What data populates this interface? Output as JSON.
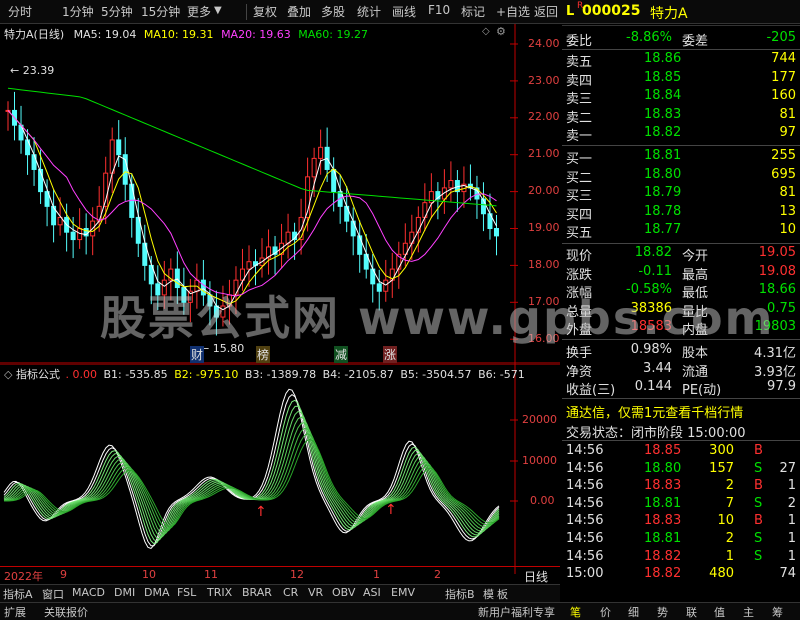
{
  "toolbar": {
    "periods": [
      "分时",
      "1分钟",
      "5分钟",
      "15分钟",
      "更多"
    ],
    "tools": [
      "复权",
      "叠加",
      "多股",
      "统计",
      "画线",
      "F10",
      "标记",
      "+自选",
      "返回"
    ]
  },
  "main": {
    "name": "特力A",
    "mode": "(日线)",
    "ma5": "MA5: 19.04",
    "ma10": "MA10: 19.31",
    "ma20": "MA20: 19.63",
    "ma60": "MA60: 19.27",
    "yticks": [
      "24.00",
      "23.00",
      "22.00",
      "21.00",
      "20.00",
      "19.00",
      "18.00",
      "17.00",
      "16.00"
    ],
    "high_label": "23.39",
    "low_label": "15.80",
    "markers": [
      "财",
      "榜",
      "减",
      "涨"
    ],
    "colors": {
      "up": "#ff3030",
      "down": "#54fcfc",
      "ma5": "#ffffff",
      "ma10": "#ffff00",
      "ma20": "#ff40ff",
      "ma60": "#00e000"
    }
  },
  "sub": {
    "title": "指标公式",
    "values": [
      ". 0.00",
      "B1: -535.85",
      "B2: -975.10",
      "B3: -1389.78",
      "B4: -2105.87",
      "B5: -3504.57",
      "B6: -571"
    ],
    "yticks": [
      "20000",
      "10000",
      "0.00"
    ]
  },
  "xaxis": {
    "labels": [
      "2022年",
      "9",
      "10",
      "11",
      "12",
      "1",
      "2"
    ],
    "period": "日线"
  },
  "bottom_tabs": [
    "指标A",
    "窗口",
    "MACD",
    "DMI",
    "DMA",
    "FSL",
    "TRIX",
    "BRAR",
    "CR",
    "VR",
    "OBV",
    "ASI",
    "EMV",
    "指标B",
    "模",
    "板"
  ],
  "status": {
    "left": [
      "扩展",
      "关联报价"
    ],
    "promo": "新用户福利专享",
    "tabs": [
      "笔",
      "价",
      "细",
      "势",
      "联",
      "值",
      "主",
      "筹"
    ]
  },
  "quote": {
    "code": "000025",
    "name": "特力A",
    "weibi_label": "委比",
    "weibi": "-8.86%",
    "weicha_label": "委差",
    "weicha": "-205",
    "asks": [
      {
        "label": "卖五",
        "price": "18.86",
        "vol": "744"
      },
      {
        "label": "卖四",
        "price": "18.85",
        "vol": "177"
      },
      {
        "label": "卖三",
        "price": "18.84",
        "vol": "160"
      },
      {
        "label": "卖二",
        "price": "18.83",
        "vol": "81"
      },
      {
        "label": "卖一",
        "price": "18.82",
        "vol": "97"
      }
    ],
    "bids": [
      {
        "label": "买一",
        "price": "18.81",
        "vol": "255"
      },
      {
        "label": "买二",
        "price": "18.80",
        "vol": "695"
      },
      {
        "label": "买三",
        "price": "18.79",
        "vol": "81"
      },
      {
        "label": "买四",
        "price": "18.78",
        "vol": "13"
      },
      {
        "label": "买五",
        "price": "18.77",
        "vol": "10"
      }
    ],
    "stats": [
      {
        "l1": "现价",
        "v1": "18.82",
        "c1": "#00e000",
        "l2": "今开",
        "v2": "19.05",
        "c2": "#ff3030"
      },
      {
        "l1": "涨跌",
        "v1": "-0.11",
        "c1": "#00e000",
        "l2": "最高",
        "v2": "19.08",
        "c2": "#ff3030"
      },
      {
        "l1": "涨幅",
        "v1": "-0.58%",
        "c1": "#00e000",
        "l2": "最低",
        "v2": "18.66",
        "c2": "#00e000"
      },
      {
        "l1": "总量",
        "v1": "38386",
        "c1": "#ffff00",
        "l2": "量比",
        "v2": "0.75",
        "c2": "#00e000"
      },
      {
        "l1": "外盘",
        "v1": "18583",
        "c1": "#ff3030",
        "l2": "内盘",
        "v2": "19803",
        "c2": "#00e000"
      }
    ],
    "stats2": [
      {
        "l1": "换手",
        "v1": "0.98%",
        "l2": "股本",
        "v2": "4.31亿"
      },
      {
        "l1": "净资",
        "v1": "3.44",
        "l2": "流通",
        "v2": "3.93亿"
      },
      {
        "l1": "收益(三)",
        "v1": "0.144",
        "l2": "PE(动)",
        "v2": "97.9"
      }
    ],
    "ad": "通达信，仅需1元查看千档行情",
    "trade_status": "交易状态：闭市阶段 15:00:00",
    "ticks": [
      {
        "t": "14:56",
        "p": "18.85",
        "v": "300",
        "s": "B"
      },
      {
        "t": "14:56",
        "p": "18.80",
        "v": "157",
        "s": "S",
        "n": "27"
      },
      {
        "t": "14:56",
        "p": "18.83",
        "v": "2",
        "s": "B",
        "n": "1"
      },
      {
        "t": "14:56",
        "p": "18.81",
        "v": "7",
        "s": "S",
        "n": "2"
      },
      {
        "t": "14:56",
        "p": "18.83",
        "v": "10",
        "s": "B",
        "n": "1"
      },
      {
        "t": "14:56",
        "p": "18.81",
        "v": "2",
        "s": "S",
        "n": "1"
      },
      {
        "t": "14:56",
        "p": "18.82",
        "v": "1",
        "s": "S",
        "n": "1"
      },
      {
        "t": "15:00",
        "p": "18.82",
        "v": "480",
        "s": "",
        "n": "74"
      }
    ]
  },
  "watermark": "股票公式网 www.gpbs.com"
}
